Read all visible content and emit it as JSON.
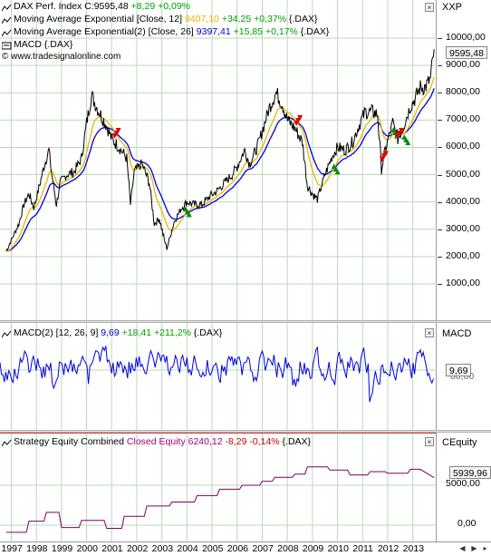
{
  "price_pane": {
    "legend": [
      {
        "name": "DAX Perf. Index",
        "parts": [
          {
            "t": "DAX Perf. Index ",
            "c": "#000000"
          },
          {
            "t": "C:9595,48",
            "c": "#000000"
          },
          {
            "t": " +8,29",
            "c": "#00a000"
          },
          {
            "t": " +0,09%",
            "c": "#00a000"
          }
        ]
      },
      {
        "name": "Moving Average Exponential",
        "parts": [
          {
            "t": "Moving Average Exponential [Close, 12] ",
            "c": "#000000"
          },
          {
            "t": "9407,10",
            "c": "#e6b800"
          },
          {
            "t": " +34,25 +0,37%",
            "c": "#00a000"
          },
          {
            "t": " {.DAX}",
            "c": "#000000"
          }
        ]
      },
      {
        "name": "Moving Average Exponential(2)",
        "parts": [
          {
            "t": "Moving Average Exponential(2) [Close, 26] ",
            "c": "#000000"
          },
          {
            "t": "9397,41",
            "c": "#0000cc"
          },
          {
            "t": " +15,85 +0,17%",
            "c": "#00a000"
          },
          {
            "t": " {.DAX}",
            "c": "#000000"
          }
        ]
      },
      {
        "name": "MACD",
        "parts": [
          {
            "t": "MACD {.DAX}",
            "c": "#000000"
          }
        ]
      }
    ],
    "watermark": "© www.tradesignalonline.com",
    "tag": "XXP",
    "y_labels": [
      "10000,00",
      "9000,00",
      "8000,00",
      "7000,00",
      "6000,00",
      "5000,00",
      "4000,00",
      "3000,00",
      "2000,00",
      "1000,00"
    ],
    "last_value": "9595,48"
  },
  "macd_pane": {
    "legend_parts": [
      {
        "t": "MACD(2) [12, 26, 9] ",
        "c": "#000000"
      },
      {
        "t": "9,69",
        "c": "#0000cc"
      },
      {
        "t": " +18,41 +211,2%",
        "c": "#00a000"
      },
      {
        "t": " {.DAX}",
        "c": "#000000"
      }
    ],
    "tag": "MACD",
    "last_value": "9,69",
    "zero_label": "00,00"
  },
  "equity_pane": {
    "legend_parts": [
      {
        "t": "Strategy Equity Combined ",
        "c": "#000000"
      },
      {
        "t": "Closed Equity",
        "c": "#a0007a"
      },
      {
        "t": " 6240,12",
        "c": "#a0007a"
      },
      {
        "t": " -8,29 -0,14%",
        "c": "#cc0000"
      },
      {
        "t": " {.DAX}",
        "c": "#000000"
      }
    ],
    "tag": "CEquity",
    "y_labels": [
      "5000,00",
      "0,00"
    ],
    "last_value": "5939,96"
  },
  "x_axis": {
    "years": [
      "1997",
      "1998",
      "1999",
      "2000",
      "2001",
      "2002",
      "2003",
      "2004",
      "2005",
      "2006",
      "2007",
      "2008",
      "2009",
      "2010",
      "2011",
      "2012",
      "2013"
    ]
  },
  "chart_data": [
    {
      "type": "line",
      "title": "DAX Perf. Index",
      "x": [
        1996.8,
        1997.0,
        1997.3,
        1997.5,
        1997.7,
        1997.9,
        1998.1,
        1998.3,
        1998.5,
        1998.6,
        1998.8,
        1998.95,
        1999.2,
        1999.5,
        1999.8,
        2000.0,
        2000.2,
        2000.5,
        2000.8,
        2001.0,
        2001.3,
        2001.6,
        2001.75,
        2001.9,
        2002.2,
        2002.5,
        2002.7,
        2002.9,
        2003.1,
        2003.2,
        2003.5,
        2003.8,
        2004.0,
        2004.3,
        2004.6,
        2004.9,
        2005.2,
        2005.5,
        2005.8,
        2006.0,
        2006.3,
        2006.5,
        2006.8,
        2007.0,
        2007.3,
        2007.55,
        2007.8,
        2008.0,
        2008.3,
        2008.6,
        2008.8,
        2009.0,
        2009.2,
        2009.5,
        2009.8,
        2010.0,
        2010.3,
        2010.6,
        2010.9,
        2011.1,
        2011.4,
        2011.6,
        2011.75,
        2011.9,
        2012.2,
        2012.4,
        2012.6,
        2012.9,
        2013.1,
        2013.3,
        2013.5,
        2013.7,
        2013.85
      ],
      "y": [
        2200,
        2600,
        3200,
        3900,
        4300,
        3800,
        4500,
        5300,
        5900,
        5100,
        3900,
        4700,
        5000,
        5100,
        5600,
        6900,
        7900,
        7300,
        6800,
        6300,
        6000,
        5600,
        3900,
        5100,
        5400,
        4700,
        3200,
        3400,
        2600,
        2300,
        3300,
        3800,
        4000,
        3900,
        3900,
        4200,
        4400,
        4700,
        5000,
        5300,
        5900,
        5400,
        6000,
        6600,
        7500,
        8000,
        7600,
        7000,
        6700,
        6200,
        4600,
        4300,
        4100,
        5000,
        5700,
        6000,
        5900,
        6200,
        6900,
        7300,
        7300,
        7200,
        5200,
        5900,
        6900,
        6300,
        6700,
        7500,
        7800,
        8200,
        8200,
        8500,
        9595
      ]
    },
    {
      "type": "line",
      "title": "MACD(2) [12, 26, 9]",
      "values_note": "oscillator around zero",
      "last": 9.69
    },
    {
      "type": "line",
      "title": "Strategy Equity Combined",
      "series": [
        {
          "name": "Closed Equity"
        }
      ],
      "x": [
        1996.8,
        1997.6,
        1997.7,
        1998.3,
        1998.4,
        1998.9,
        1999.0,
        1999.7,
        1999.8,
        2000.7,
        2000.8,
        2001.4,
        2001.5,
        2002.3,
        2002.4,
        2003.3,
        2003.4,
        2004.3,
        2004.4,
        2005.2,
        2005.3,
        2006.1,
        2006.2,
        2006.9,
        2007.0,
        2007.4,
        2007.5,
        2008.2,
        2008.3,
        2008.7,
        2008.8,
        2009.6,
        2009.7,
        2010.4,
        2010.5,
        2011.2,
        2011.3,
        2011.9,
        2012.0,
        2012.8,
        2012.9,
        2013.3,
        2013.4,
        2013.85
      ],
      "y": [
        -900,
        -900,
        500,
        500,
        1600,
        1600,
        -300,
        -300,
        600,
        600,
        -400,
        -400,
        1100,
        1100,
        2400,
        2400,
        2900,
        2900,
        3700,
        3700,
        4500,
        4500,
        5000,
        5000,
        5500,
        5500,
        6000,
        6000,
        6400,
        6400,
        7300,
        7300,
        6900,
        6900,
        6300,
        6300,
        6700,
        6700,
        6500,
        6500,
        7000,
        7000,
        6800,
        5940
      ]
    }
  ]
}
